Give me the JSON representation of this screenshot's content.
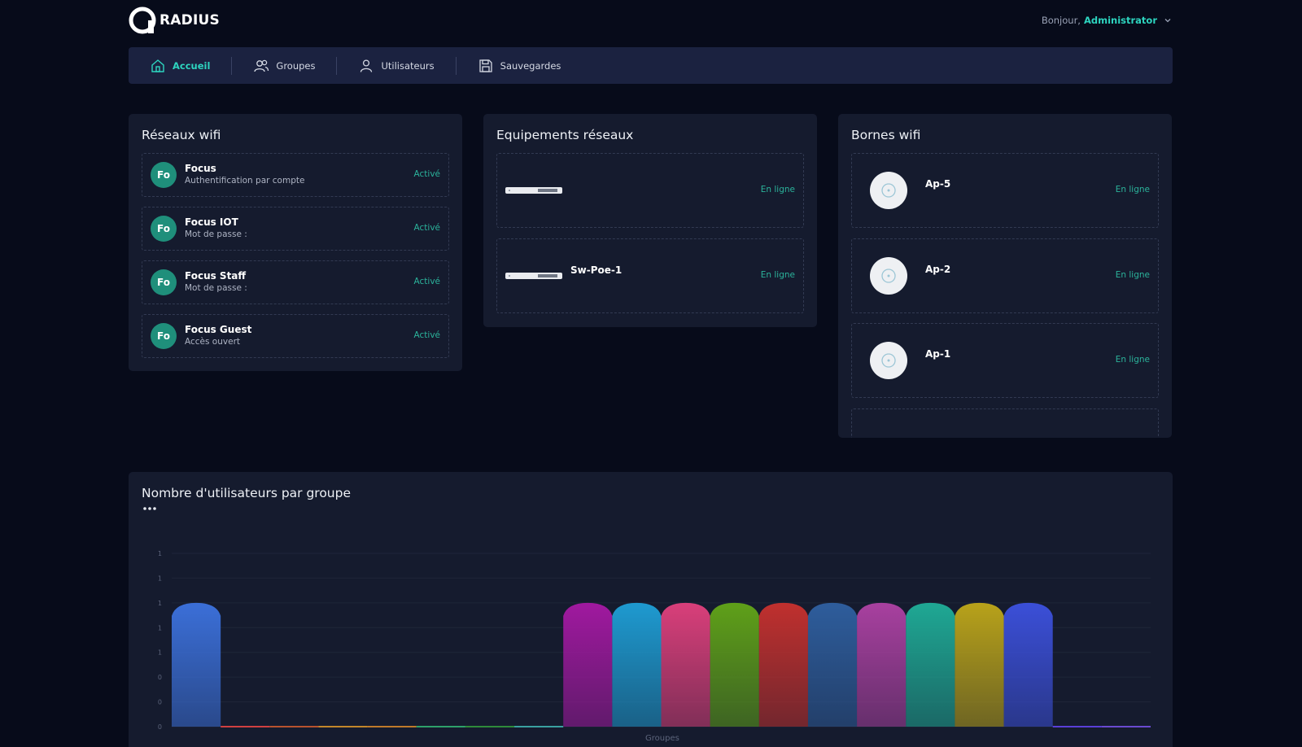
{
  "app": {
    "name": "RADIUS"
  },
  "header": {
    "greeting": "Bonjour,",
    "user": "Administrator"
  },
  "nav": {
    "items": [
      {
        "label": "Accueil",
        "icon": "home-icon",
        "active": true
      },
      {
        "label": "Groupes",
        "icon": "users-group-icon",
        "active": false
      },
      {
        "label": "Utilisateurs",
        "icon": "user-icon",
        "active": false
      },
      {
        "label": "Sauvegardes",
        "icon": "save-icon",
        "active": false
      }
    ]
  },
  "wifi_networks": {
    "title": "Réseaux wifi",
    "items": [
      {
        "initials": "Fo",
        "name": "Focus",
        "subtitle": "Authentification par compte",
        "status": "Activé"
      },
      {
        "initials": "Fo",
        "name": "Focus IOT",
        "subtitle": "Mot de passe :",
        "status": "Activé"
      },
      {
        "initials": "Fo",
        "name": "Focus Staff",
        "subtitle": "Mot de passe :",
        "status": "Activé"
      },
      {
        "initials": "Fo",
        "name": "Focus Guest",
        "subtitle": "Accès ouvert",
        "status": "Activé"
      }
    ]
  },
  "network_equipment": {
    "title": "Equipements réseaux",
    "items": [
      {
        "name": "",
        "icon": "switch-icon",
        "status": "En ligne"
      },
      {
        "name": "Sw-Poe-1",
        "icon": "switch-icon",
        "status": "En ligne"
      }
    ]
  },
  "access_points": {
    "title": "Bornes wifi",
    "items": [
      {
        "name": "Ap-5",
        "icon": "access-point-icon",
        "status": "En ligne"
      },
      {
        "name": "Ap-2",
        "icon": "access-point-icon",
        "status": "En ligne"
      },
      {
        "name": "Ap-1",
        "icon": "access-point-icon",
        "status": "En ligne"
      }
    ]
  },
  "chart_data": {
    "type": "area",
    "title": "Nombre d'utilisateurs par groupe",
    "xlabel": "Groupes",
    "ylabel": "",
    "y_tick_labels": [
      "1",
      "1",
      "1",
      "1",
      "1",
      "0",
      "0",
      "0"
    ],
    "ylim": [
      0,
      1.4
    ],
    "grid": true,
    "series": [
      {
        "values": [
          1,
          0,
          0,
          0,
          0,
          0,
          0,
          0,
          1,
          1,
          1,
          1,
          1,
          1,
          1,
          1,
          1,
          1,
          0,
          0
        ],
        "colors": [
          "#3b6fd8",
          "#d04040",
          "#b8522e",
          "#c2872a",
          "#bf7a2a",
          "#2ea06a",
          "#2e8a3a",
          "#3aa0a0",
          "#a0199f",
          "#1e9ad0",
          "#d93f7a",
          "#5fa019",
          "#c0302e",
          "#2e5d9c",
          "#a8409f",
          "#1fa894",
          "#b8a21a",
          "#3b4fd8",
          "#5a3fd8",
          "#6a4ad0"
        ]
      }
    ]
  },
  "colors": {
    "accent": "#2dd4bf",
    "status_online": "#2bb39b",
    "badge": "#1f8f7b",
    "background": "#070b1a",
    "card": "#151b2e",
    "nav": "#1b2240"
  }
}
